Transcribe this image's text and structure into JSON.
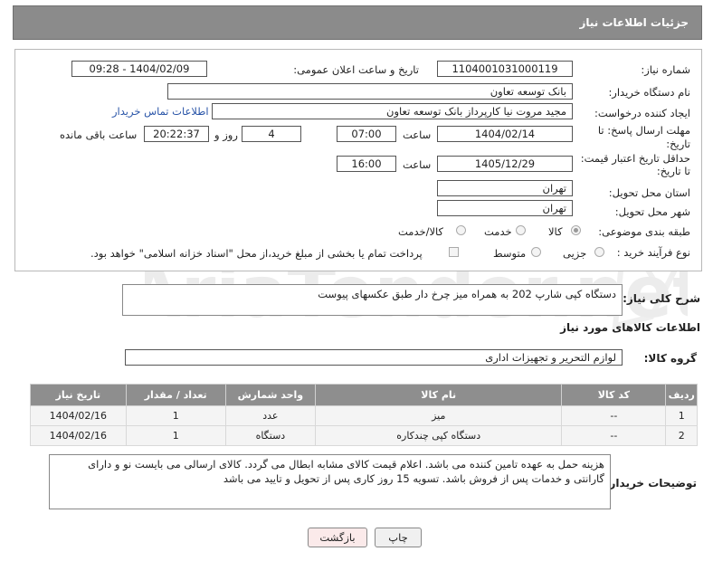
{
  "header": {
    "title": "جزئیات اطلاعات نیاز"
  },
  "form": {
    "need_number_label": "شماره نیاز:",
    "need_number": "1104001031000119",
    "announce_label": "تاریخ و ساعت اعلان عمومی:",
    "announce_value": "1404/02/09 - 09:28",
    "buyer_org_label": "نام دستگاه خریدار:",
    "buyer_org": "بانک توسعه تعاون",
    "creator_label": "ایجاد کننده درخواست:",
    "creator": "مجید مروت نیا کارپرداز بانک توسعه تعاون",
    "contact_link": "اطلاعات تماس خریدار",
    "deadline_label_1": "مهلت ارسال پاسخ: تا",
    "deadline_label_2": "تاریخ:",
    "deadline_date": "1404/02/14",
    "time_label": "ساعت",
    "deadline_time": "07:00",
    "days_value": "4",
    "days_label": "روز و",
    "remaining_time": "20:22:37",
    "remaining_label": "ساعت باقی مانده",
    "validity_label_1": "حداقل تاریخ اعتبار قیمت:",
    "validity_label_2": "تا تاریخ:",
    "validity_date": "1405/12/29",
    "validity_time": "16:00",
    "province_label": "استان محل تحویل:",
    "province": "تهران",
    "city_label": "شهر محل تحویل:",
    "city": "تهران",
    "category_label": "طبقه بندی موضوعی:",
    "category_options": [
      "کالا",
      "خدمت",
      "کالا/خدمت"
    ],
    "process_label": "نوع فرآیند خرید :",
    "process_options": [
      "جزیی",
      "متوسط"
    ],
    "payment_note": "پرداخت تمام یا بخشی از مبلغ خرید،از محل \"اسناد خزانه اسلامی\" خواهد بود."
  },
  "summary": {
    "label": "شرح کلی نیاز:",
    "text": "دستگاه کپی شارپ 202 به همراه میز چرخ دار طبق عکسهای پیوست"
  },
  "goods": {
    "section_title": "اطلاعات کالاهای مورد نیاز",
    "group_label": "گروه کالا:",
    "group_value": "لوازم التحریر و تجهیزات اداری",
    "columns": [
      "ردیف",
      "کد کالا",
      "نام کالا",
      "واحد شمارش",
      "تعداد / مقدار",
      "تاریخ نیاز"
    ],
    "rows": [
      [
        "1",
        "--",
        "میز",
        "عدد",
        "1",
        "1404/02/16"
      ],
      [
        "2",
        "--",
        "دستگاه کپی چندکاره",
        "دستگاه",
        "1",
        "1404/02/16"
      ]
    ]
  },
  "notes": {
    "label": "توضیحات خریدار:",
    "text": "هزینه حمل به عهده تامین کننده می باشد. اعلام قیمت کالای مشابه ابطال می گردد. کالای ارسالی می بایست نو و دارای گارانتی و خدمات پس از فروش باشد. تسویه 15 روز کاری پس از تحویل و تایید می باشد"
  },
  "buttons": {
    "print": "چاپ",
    "back": "بازگشت"
  },
  "watermark": {
    "text": "AriaTender.net"
  }
}
